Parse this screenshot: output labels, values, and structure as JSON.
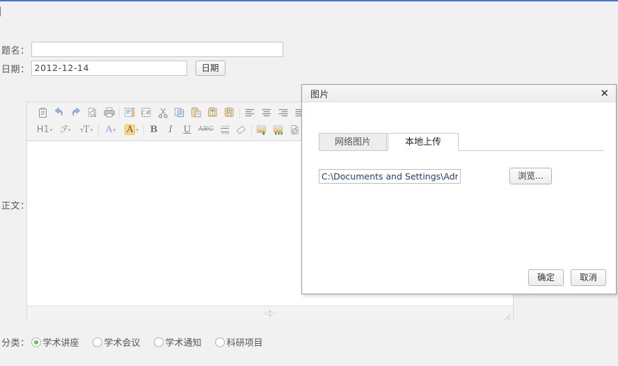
{
  "page": {
    "stray_glyph": "】",
    "accent_color": "#4472d8",
    "background_color": "#f1f1f1"
  },
  "form": {
    "title_field": {
      "label": "题名：",
      "value": "",
      "placeholder": ""
    },
    "date_field": {
      "label": "日期：",
      "value": "2012-12-14",
      "button_label": "日期"
    },
    "body_field": {
      "label": "正文：",
      "content": ""
    },
    "category": {
      "label": "分类：",
      "options": [
        {
          "label": "学术讲座",
          "checked": true
        },
        {
          "label": "学术会议",
          "checked": false
        },
        {
          "label": "学术通知",
          "checked": false
        },
        {
          "label": "科研项目",
          "checked": false
        }
      ]
    }
  },
  "editor": {
    "toolbar_row1": [
      {
        "name": "paste-clipboard-icon",
        "kind": "icon"
      },
      {
        "name": "undo-icon",
        "kind": "icon"
      },
      {
        "name": "redo-icon",
        "kind": "icon"
      },
      {
        "name": "preview-icon",
        "kind": "icon"
      },
      {
        "name": "print-icon",
        "kind": "icon"
      },
      {
        "name": "source-code-icon",
        "kind": "icon"
      },
      {
        "name": "csharp-code-icon",
        "kind": "icon"
      },
      {
        "name": "cut-icon",
        "kind": "icon"
      },
      {
        "name": "copy-icon",
        "kind": "icon"
      },
      {
        "name": "paste-plain-icon",
        "kind": "icon"
      },
      {
        "name": "paste-text-icon",
        "kind": "icon"
      },
      {
        "name": "paste-word-icon",
        "kind": "icon"
      },
      {
        "name": "align-left-icon",
        "kind": "icon"
      },
      {
        "name": "align-center-icon",
        "kind": "icon"
      },
      {
        "name": "align-right-icon",
        "kind": "icon"
      },
      {
        "name": "align-justify-icon",
        "kind": "icon"
      }
    ],
    "toolbar_row2": [
      {
        "name": "heading-dropdown",
        "kind": "text",
        "label": "H1"
      },
      {
        "name": "font-family-dropdown",
        "kind": "text",
        "label": "ℱ"
      },
      {
        "name": "font-size-dropdown",
        "kind": "text",
        "label": "ᴛT"
      },
      {
        "name": "text-color-dropdown",
        "kind": "text",
        "label": "A"
      },
      {
        "name": "highlight-color-dropdown",
        "kind": "text",
        "label": "A"
      },
      {
        "name": "bold-icon",
        "kind": "text",
        "label": "B"
      },
      {
        "name": "italic-icon",
        "kind": "text",
        "label": "I"
      },
      {
        "name": "underline-icon",
        "kind": "text",
        "label": "U"
      },
      {
        "name": "strikethrough-icon",
        "kind": "text",
        "label": "ABC"
      },
      {
        "name": "line-height-icon",
        "kind": "icon"
      },
      {
        "name": "clear-format-icon",
        "kind": "icon"
      },
      {
        "name": "insert-image-icon",
        "kind": "icon"
      },
      {
        "name": "image-gallery-icon",
        "kind": "icon"
      },
      {
        "name": "attachment-icon",
        "kind": "icon"
      },
      {
        "name": "insert-table-icon",
        "kind": "icon"
      }
    ]
  },
  "dialog": {
    "title": "图片",
    "close_label": "✕",
    "tabs": [
      {
        "label": "网络图片",
        "active": false
      },
      {
        "label": "本地上传",
        "active": true
      }
    ],
    "file_path": {
      "value": "C:\\Documents and Settings\\Adminis",
      "browse_label": "浏览..."
    },
    "footer": {
      "confirm_label": "确定",
      "cancel_label": "取消"
    }
  }
}
